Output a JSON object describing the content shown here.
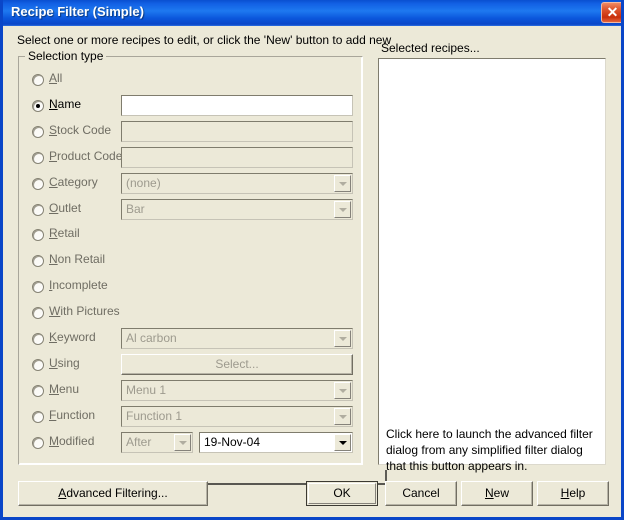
{
  "window": {
    "title": "Recipe Filter (Simple)",
    "close_icon": "close-x-icon",
    "accent_color": "#1e79f0",
    "face_color": "#ece9d8",
    "close_color": "#c9300c"
  },
  "header": {
    "instruction": "Select one or more recipes to edit, or click the 'New' button to add new",
    "selected_label": "Selected recipes..."
  },
  "group": {
    "legend": "Selection type"
  },
  "rows": [
    {
      "label": "All",
      "mnemonic": "A",
      "checked": false,
      "control": null
    },
    {
      "label": "Name",
      "mnemonic": "N",
      "checked": true,
      "control": {
        "type": "textbox",
        "value": "",
        "enabled": true
      }
    },
    {
      "label": "Stock Code",
      "mnemonic": "S",
      "checked": false,
      "control": {
        "type": "textbox",
        "value": "",
        "enabled": false
      }
    },
    {
      "label": "Product Code",
      "mnemonic": "P",
      "checked": false,
      "control": {
        "type": "textbox",
        "value": "",
        "enabled": false
      }
    },
    {
      "label": "Category",
      "mnemonic": "C",
      "checked": false,
      "control": {
        "type": "combo",
        "value": "(none)",
        "enabled": false
      }
    },
    {
      "label": "Outlet",
      "mnemonic": "O",
      "checked": false,
      "control": {
        "type": "combo",
        "value": "Bar",
        "enabled": false
      }
    },
    {
      "label": "Retail",
      "mnemonic": "R",
      "checked": false,
      "control": null
    },
    {
      "label": "Non Retail",
      "mnemonic": "N",
      "checked": false,
      "control": null
    },
    {
      "label": "Incomplete",
      "mnemonic": "I",
      "checked": false,
      "control": null
    },
    {
      "label": "With Pictures",
      "mnemonic": "W",
      "checked": false,
      "control": null
    },
    {
      "label": "Keyword",
      "mnemonic": "K",
      "checked": false,
      "control": {
        "type": "combo",
        "value": "Al carbon",
        "enabled": false
      }
    },
    {
      "label": "Using",
      "mnemonic": "U",
      "checked": false,
      "control": {
        "type": "button",
        "value": "Select...",
        "enabled": false
      }
    },
    {
      "label": "Menu",
      "mnemonic": "M",
      "checked": false,
      "control": {
        "type": "combo",
        "value": "Menu 1",
        "enabled": false
      }
    },
    {
      "label": "Function",
      "mnemonic": "F",
      "checked": false,
      "control": {
        "type": "combo",
        "value": "Function 1",
        "enabled": false
      }
    },
    {
      "label": "Modified",
      "mnemonic": "M",
      "checked": false,
      "control": {
        "type": "combo-pair",
        "value": "After",
        "enabled": false,
        "value2": "19-Nov-04",
        "enabled2": true
      }
    }
  ],
  "recipe_list": {
    "items": []
  },
  "callout": {
    "text": "Click here to launch the advanced filter dialog from any simplified filter dialog that this button appears in."
  },
  "buttons": {
    "advanced": {
      "label": "Advanced Filtering...",
      "mnemonic": "A"
    },
    "ok": {
      "label": "OK",
      "default": true
    },
    "cancel": {
      "label": "Cancel"
    },
    "new": {
      "label": "New",
      "mnemonic": "N"
    },
    "help": {
      "label": "Help",
      "mnemonic": "H"
    }
  }
}
